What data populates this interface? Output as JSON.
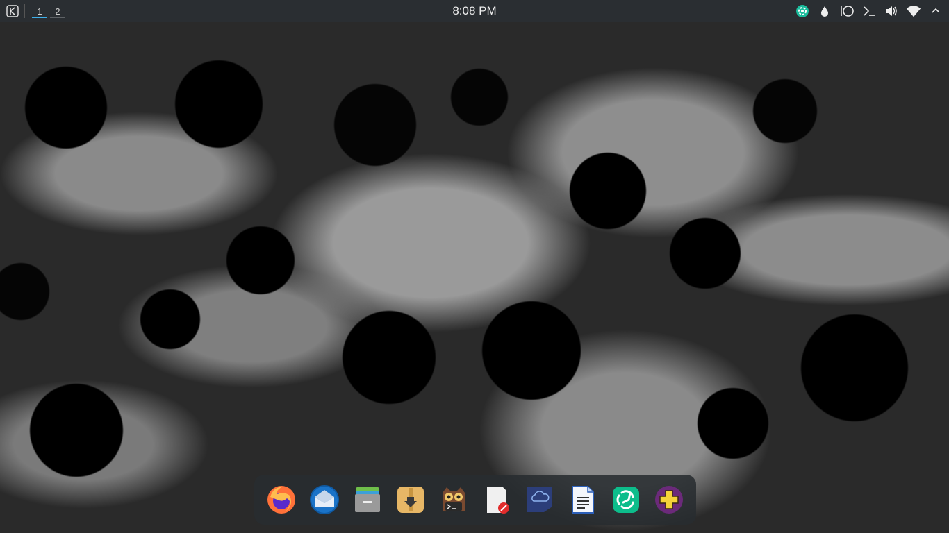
{
  "panel": {
    "virtual_desktops": [
      {
        "label": "1",
        "active": true
      },
      {
        "label": "2",
        "active": false
      }
    ],
    "clock": "8:08 PM",
    "tray_icons": [
      "vpn-shield-icon",
      "droplet-icon",
      "circle-icon",
      "terminal-icon",
      "volume-icon",
      "wifi-icon"
    ]
  },
  "dock": {
    "apps": [
      {
        "name": "firefox",
        "icon": "firefox-icon"
      },
      {
        "name": "thunderbird",
        "icon": "thunderbird-icon"
      },
      {
        "name": "file-manager",
        "icon": "file-manager-icon"
      },
      {
        "name": "archive-manager",
        "icon": "archive-manager-icon"
      },
      {
        "name": "terminal",
        "icon": "terminal-owl-icon"
      },
      {
        "name": "text-editor",
        "icon": "text-editor-icon"
      },
      {
        "name": "cloud-sync",
        "icon": "cloud-sync-icon"
      },
      {
        "name": "document-writer",
        "icon": "document-writer-icon"
      },
      {
        "name": "element-chat",
        "icon": "element-chat-icon"
      },
      {
        "name": "health-app",
        "icon": "health-cross-icon"
      }
    ]
  },
  "colors": {
    "panel_bg": "#2a2e32",
    "active_desktop_indicator": "#3daee9",
    "dock_bg": "#282c30"
  }
}
